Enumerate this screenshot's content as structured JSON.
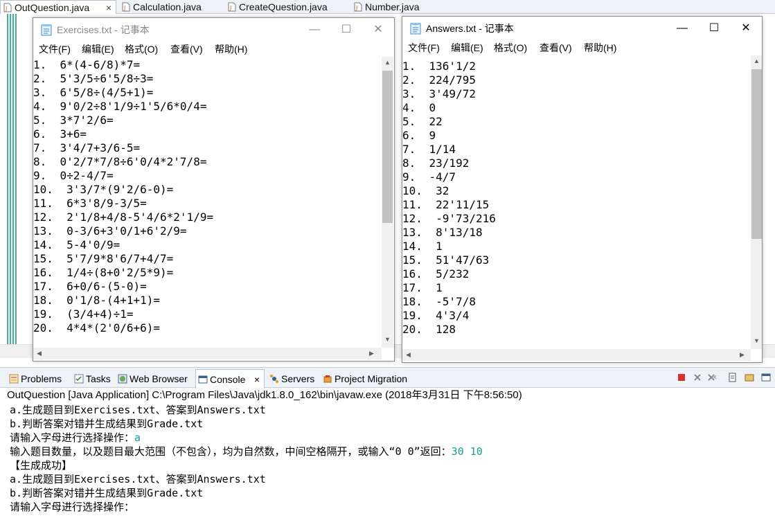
{
  "editor_tabs": [
    {
      "label": "OutQuestion.java",
      "active": true
    },
    {
      "label": "Calculation.java",
      "active": false
    },
    {
      "label": "CreateQuestion.java",
      "active": false
    },
    {
      "label": "Number.java",
      "active": false
    }
  ],
  "editor_tab_close": "×",
  "exercises_window": {
    "title": "Exercises.txt - 记事本",
    "menus": [
      "文件(F)",
      "编辑(E)",
      "格式(O)",
      "查看(V)",
      "帮助(H)"
    ],
    "lines": [
      "1.  6*(4-6/8)*7=",
      "2.  5'3/5÷6'5/8÷3=",
      "3.  6'5/8÷(4/5+1)=",
      "4.  9'0/2÷8'1/9÷1'5/6*0/4=",
      "5.  3*7'2/6=",
      "6.  3+6=",
      "7.  3'4/7+3/6-5=",
      "8.  0'2/7*7/8÷6'0/4*2'7/8=",
      "9.  0÷2-4/7=",
      "10.  3'3/7*(9'2/6-0)=",
      "11.  6*3'8/9-3/5=",
      "12.  2'1/8+4/8-5'4/6*2'1/9=",
      "13.  0-3/6+3'0/1+6'2/9=",
      "14.  5-4'0/9=",
      "15.  5'7/9*8'6/7+4/7=",
      "16.  1/4÷(8+0'2/5*9)=",
      "17.  6+0/6-(5-0)=",
      "18.  0'1/8-(4+1+1)=",
      "19.  (3/4+4)÷1=",
      "20.  4*4*(2'0/6+6)="
    ]
  },
  "answers_window": {
    "title": "Answers.txt - 记事本",
    "menus": [
      "文件(F)",
      "编辑(E)",
      "格式(O)",
      "查看(V)",
      "帮助(H)"
    ],
    "lines": [
      "1.  136'1/2",
      "2.  224/795",
      "3.  3'49/72",
      "4.  0",
      "5.  22",
      "6.  9",
      "7.  1/14",
      "8.  23/192",
      "9.  -4/7",
      "10.  32",
      "11.  22'11/15",
      "12.  -9'73/216",
      "13.  8'13/18",
      "14.  1",
      "15.  51'47/63",
      "16.  5/232",
      "17.  1",
      "18.  -5'7/8",
      "19.  4'3/4",
      "20.  128"
    ]
  },
  "window_buttons": {
    "minimize": "—",
    "maximize": "☐",
    "close": "✕"
  },
  "scroll_arrows": {
    "up": "▲",
    "down": "▼",
    "left": "◀",
    "right": "▶"
  },
  "view_tabs": [
    {
      "label": "Problems",
      "active": false
    },
    {
      "label": "Tasks",
      "active": false
    },
    {
      "label": "Web Browser",
      "active": false
    },
    {
      "label": "Console",
      "active": true
    },
    {
      "label": "Servers",
      "active": false
    },
    {
      "label": "Project Migration",
      "active": false
    }
  ],
  "console": {
    "header": "OutQuestion [Java Application] C:\\Program Files\\Java\\jdk1.8.0_162\\bin\\javaw.exe (2018年3月31日 下午8:56:50)",
    "lines": [
      {
        "text": "a.生成题目到Exercises.txt、答案到Answers.txt",
        "input": ""
      },
      {
        "text": "b.判断答案对错并生成结果到Grade.txt",
        "input": ""
      },
      {
        "text": "请输入字母进行选择操作：",
        "input": "a"
      },
      {
        "text": "输入题目数量，以及题目最大范围（不包含），均为自然数，中间空格隔开，或输入“0 0”返回：",
        "input": "30 10"
      },
      {
        "text": "【生成成功】",
        "input": ""
      },
      {
        "text": "a.生成题目到Exercises.txt、答案到Answers.txt",
        "input": ""
      },
      {
        "text": "b.判断答案对错并生成结果到Grade.txt",
        "input": ""
      },
      {
        "text": "请输入字母进行选择操作：",
        "input": ""
      }
    ]
  },
  "colors": {
    "console_input": "#13a391",
    "eclipse_chrome": "#eef1f6",
    "terminate_red": "#d9302c"
  }
}
